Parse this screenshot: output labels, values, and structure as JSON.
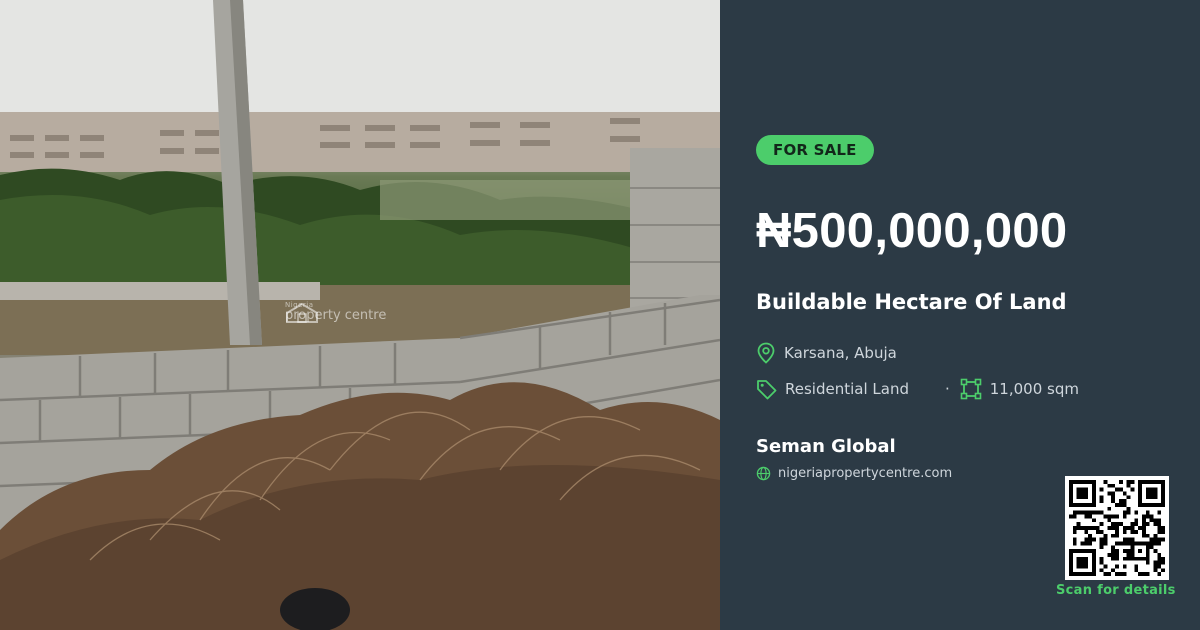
{
  "photo": {
    "watermark_small": "Nigeria",
    "watermark_big": "property centre"
  },
  "listing": {
    "status": "FOR SALE",
    "price": "₦500,000,000",
    "title": "Buildable Hectare Of Land",
    "location": "Karsana, Abuja",
    "type": "Residential Land",
    "separator": "·",
    "size": "11,000 sqm"
  },
  "agent": {
    "name": "Seman Global",
    "website": "nigeriapropertycentre.com"
  },
  "qr": {
    "caption": "Scan for details"
  },
  "icons": {
    "location": "map-pin-icon",
    "type": "tag-icon",
    "size": "area-icon",
    "website": "globe-icon"
  },
  "colors": {
    "panel_bg": "#2c3a45",
    "accent": "#4ccd6b",
    "text_primary": "#ffffff",
    "text_secondary": "#cfd6dc"
  }
}
